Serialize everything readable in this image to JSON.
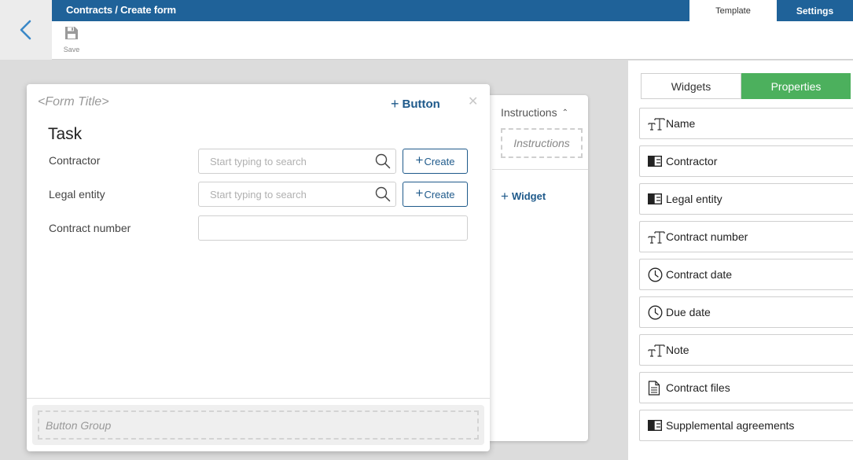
{
  "header": {
    "breadcrumb": "Contracts / Create form",
    "tabs": [
      {
        "label": "Template",
        "active": true
      },
      {
        "label": "Settings",
        "active": false
      }
    ],
    "colors": {
      "bar": "#1f6299"
    }
  },
  "toolbar": {
    "save_label": "Save"
  },
  "form": {
    "title_placeholder": "<Form Title>",
    "add_button_label": "Button",
    "section_title": "Task",
    "fields": [
      {
        "label": "Contractor",
        "placeholder": "Start typing to search",
        "create_label": "Create"
      },
      {
        "label": "Legal entity",
        "placeholder": "Start typing to search",
        "create_label": "Create"
      },
      {
        "label": "Contract number",
        "value": ""
      }
    ],
    "button_group_label": "Button Group"
  },
  "instructions": {
    "header": "Instructions",
    "placeholder": "Instructions",
    "add_widget_label": "Widget"
  },
  "right_panel": {
    "tabs": [
      {
        "label": "Widgets",
        "active": false
      },
      {
        "label": "Properties",
        "active": true
      }
    ],
    "active_color": "#4cb05d",
    "properties": [
      {
        "label": "Name",
        "icon": "text-icon"
      },
      {
        "label": "Contractor",
        "icon": "app-icon"
      },
      {
        "label": "Legal entity",
        "icon": "app-icon"
      },
      {
        "label": "Contract number",
        "icon": "text-icon"
      },
      {
        "label": "Contract date",
        "icon": "clock-icon"
      },
      {
        "label": "Due date",
        "icon": "clock-icon"
      },
      {
        "label": "Note",
        "icon": "text-icon"
      },
      {
        "label": "Contract files",
        "icon": "file-icon"
      },
      {
        "label": "Supplemental agreements",
        "icon": "app-icon"
      }
    ]
  }
}
